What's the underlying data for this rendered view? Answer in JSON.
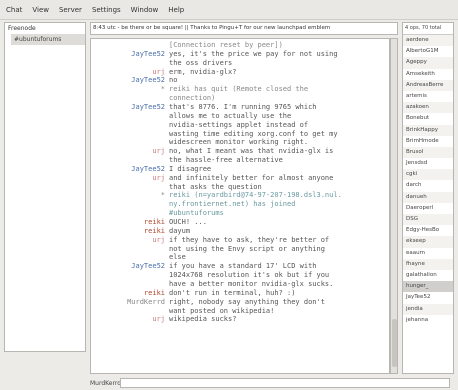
{
  "menu": [
    "Chat",
    "View",
    "Server",
    "Settings",
    "Window",
    "Help"
  ],
  "sidebar": {
    "items": [
      {
        "label": "Freenode",
        "selected": false
      },
      {
        "label": "#ubuntuforums",
        "selected": true
      }
    ]
  },
  "topic": "8:43 utc - be there or be square! || Thanks to Pingu+T for our new launchpad emblem",
  "chat": [
    {
      "nick": "",
      "text": "[Connection reset by peer])",
      "nickClass": "c-gray",
      "msgClass": "c-gray"
    },
    {
      "nick": "JayTee52",
      "text": "yes, it's the price we pay for not using",
      "nickClass": "c-blue",
      "msgClass": ""
    },
    {
      "nick": "",
      "text": "the oss drivers",
      "nickClass": "",
      "msgClass": ""
    },
    {
      "nick": "urj",
      "text": "erm, nvidia-glx?",
      "nickClass": "c-pink",
      "msgClass": ""
    },
    {
      "nick": "JayTee52",
      "text": "no",
      "nickClass": "c-blue",
      "msgClass": ""
    },
    {
      "nick": "*",
      "text": "reiki has quit (Remote closed the",
      "nickClass": "c-gray",
      "msgClass": "c-gray"
    },
    {
      "nick": "",
      "text": "connection)",
      "nickClass": "",
      "msgClass": "c-gray"
    },
    {
      "nick": "JayTee52",
      "text": "that's 8776. I'm running 9765 which",
      "nickClass": "c-blue",
      "msgClass": ""
    },
    {
      "nick": "",
      "text": "allows me to actually use the",
      "nickClass": "",
      "msgClass": ""
    },
    {
      "nick": "",
      "text": "nvidia-settings applet instead of",
      "nickClass": "",
      "msgClass": ""
    },
    {
      "nick": "",
      "text": "wasting time editing xorg.conf to get my",
      "nickClass": "",
      "msgClass": ""
    },
    {
      "nick": "",
      "text": "widescreen monitor working right.",
      "nickClass": "",
      "msgClass": ""
    },
    {
      "nick": "urj",
      "text": "no, what I meant was that nvidia-glx is",
      "nickClass": "c-pink",
      "msgClass": ""
    },
    {
      "nick": "",
      "text": "the hassle-free alternative",
      "nickClass": "",
      "msgClass": ""
    },
    {
      "nick": "JayTee52",
      "text": "I disagree",
      "nickClass": "c-blue",
      "msgClass": ""
    },
    {
      "nick": "urj",
      "text": "and infinitely better for almost anyone",
      "nickClass": "c-pink",
      "msgClass": ""
    },
    {
      "nick": "",
      "text": "that asks the question",
      "nickClass": "",
      "msgClass": ""
    },
    {
      "nick": "*",
      "text": "reiki (n=yardbird@74-97-207-198.dsl3.nul.",
      "nickClass": "c-gray",
      "msgClass": "c-teal"
    },
    {
      "nick": "",
      "text": "ny.frontiernet.net) has joined",
      "nickClass": "",
      "msgClass": "c-teal"
    },
    {
      "nick": "",
      "text": "#ubuntuforums",
      "nickClass": "",
      "msgClass": "c-teal"
    },
    {
      "nick": "reiki",
      "text": "OUCH! ...",
      "nickClass": "c-red",
      "msgClass": ""
    },
    {
      "nick": "reiki",
      "text": "dayum",
      "nickClass": "c-red",
      "msgClass": ""
    },
    {
      "nick": "urj",
      "text": "if they have to ask, they're better of",
      "nickClass": "c-pink",
      "msgClass": ""
    },
    {
      "nick": "",
      "text": "not using the Envy script or anything",
      "nickClass": "",
      "msgClass": ""
    },
    {
      "nick": "",
      "text": "else",
      "nickClass": "",
      "msgClass": ""
    },
    {
      "nick": "JayTee52",
      "text": "if you have a standard 17' LCD with",
      "nickClass": "c-blue",
      "msgClass": ""
    },
    {
      "nick": "",
      "text": "1024x768 resolution it's ok but if you",
      "nickClass": "",
      "msgClass": ""
    },
    {
      "nick": "",
      "text": "have a better monitor nvidia-glx sucks.",
      "nickClass": "",
      "msgClass": ""
    },
    {
      "nick": "reiki",
      "text": "don't run in terminal, huh? :)",
      "nickClass": "c-red",
      "msgClass": ""
    },
    {
      "nick": "MurdKerrd",
      "text": "right, nobody say anything they don't",
      "nickClass": "c-gray",
      "msgClass": ""
    },
    {
      "nick": "",
      "text": "want posted on wikipedia!",
      "nickClass": "",
      "msgClass": ""
    },
    {
      "nick": "urj",
      "text": "wikipedia sucks?",
      "nickClass": "c-pink",
      "msgClass": ""
    }
  ],
  "userlist": {
    "header": "4 ops, 70 total",
    "users": [
      "aerdene",
      "AlbertoG1M",
      "Ageppy",
      "Amsekeith",
      "AndreasBerre",
      "artemis",
      "azakoen",
      "Bonebut",
      "BrinkHappy",
      "BrimHmode",
      "Brusol",
      "Jensdsd",
      "cgki",
      "darch",
      "danueh",
      "Daeroperl",
      "DSG",
      "Edgy-HesBo",
      "ekseep",
      "eaaum",
      "fhayne",
      "galathalion",
      "hunger_",
      "JayTee52",
      "jendia",
      "jehanna"
    ],
    "selected": "hunger_"
  },
  "input": {
    "label": "MurdKerrd",
    "value": ""
  }
}
